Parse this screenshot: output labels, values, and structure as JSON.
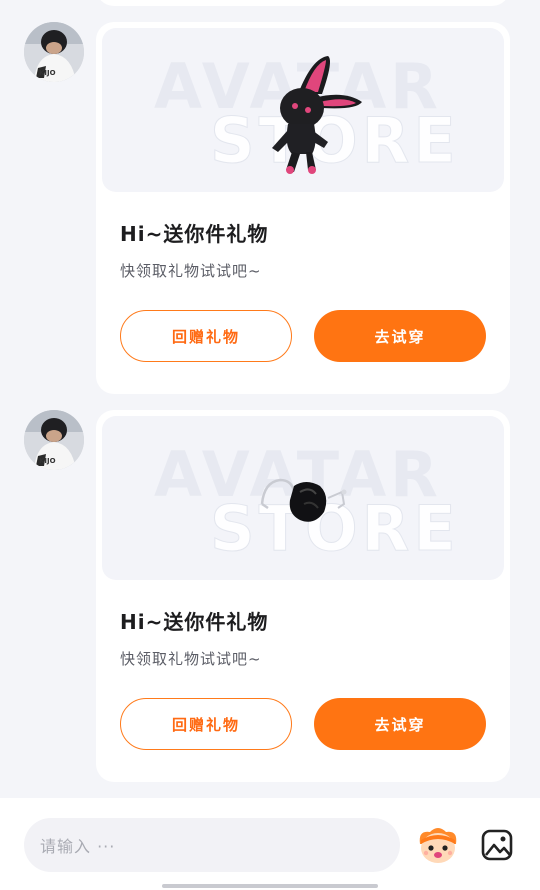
{
  "messages": [
    {
      "card": {
        "watermark_line1": "AVATAR",
        "watermark_line2": "STORE",
        "gift_icon": "black-rabbit-plush-icon",
        "title": "Hi~送你件礼物",
        "subtitle": "快领取礼物试试吧~",
        "return_gift_label": "回赠礼物",
        "try_on_label": "去试穿"
      }
    },
    {
      "card": {
        "watermark_line1": "AVATAR",
        "watermark_line2": "STORE",
        "gift_icon": "black-bag-charm-icon",
        "title": "Hi~送你件礼物",
        "subtitle": "快领取礼物试试吧~",
        "return_gift_label": "回赠礼物",
        "try_on_label": "去试穿"
      }
    }
  ],
  "composer": {
    "placeholder": "请输入 ···",
    "emoji_icon": "mascot-emoji-icon",
    "image_icon": "image-picker-icon"
  },
  "colors": {
    "accent": "#ff7412",
    "background": "#f4f5f9",
    "card": "#ffffff"
  }
}
